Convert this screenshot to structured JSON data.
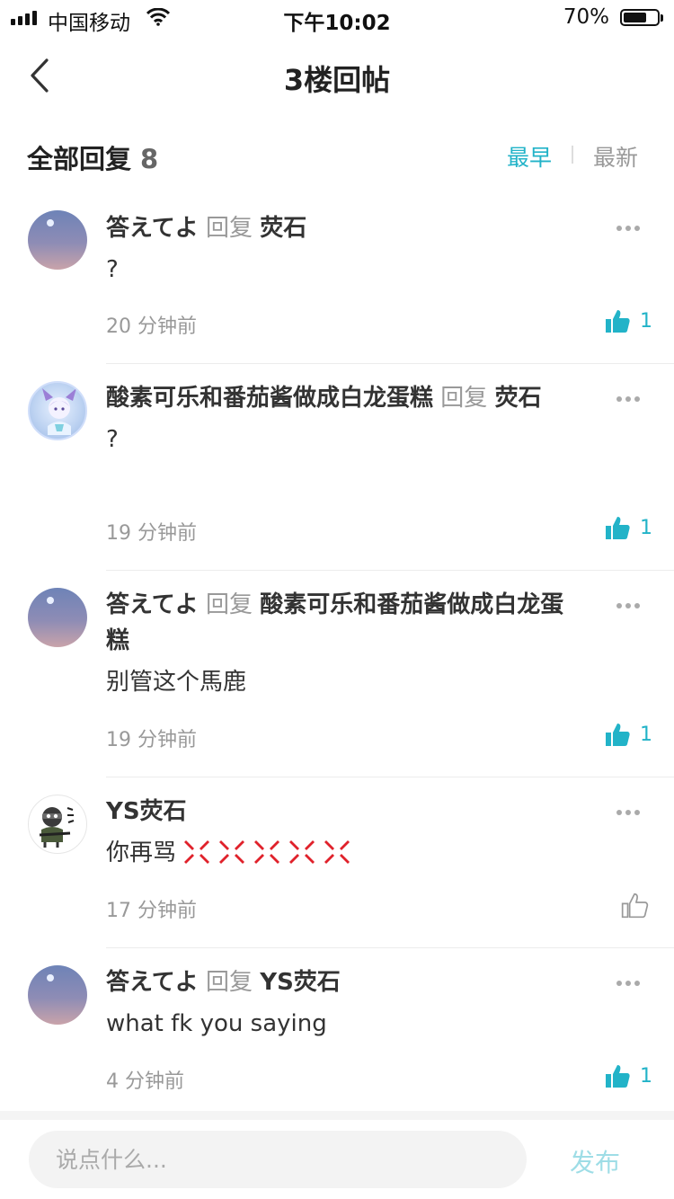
{
  "status_bar": {
    "carrier": "中国移动",
    "time": "下午10:02",
    "battery": "70%",
    "battery_level": 0.7
  },
  "nav": {
    "title": "3楼回帖"
  },
  "header": {
    "title": "全部回复",
    "count": "8",
    "sort_earliest": "最早",
    "sort_newest": "最新"
  },
  "reply_word": "回复",
  "comments": [
    {
      "user": "答えてよ",
      "target": "荧石",
      "text": "?",
      "time": "20 分钟前",
      "likes": "1",
      "liked": true
    },
    {
      "user": "酸素可乐和番茄酱做成白龙蛋糕",
      "target": "荧石",
      "text": "?",
      "time": "19 分钟前",
      "likes": "1",
      "liked": true
    },
    {
      "user": "答えてよ",
      "target": "酸素可乐和番茄酱做成白龙蛋糕",
      "text": "别管这个馬鹿",
      "time": "19 分钟前",
      "likes": "1",
      "liked": true
    },
    {
      "user": "YS荧石",
      "target": "",
      "text": "你再骂",
      "time": "17 分钟前",
      "likes": "",
      "liked": false
    },
    {
      "user": "答えてよ",
      "target": "YS荧石",
      "text": "what fk you saying",
      "time": "4 分钟前",
      "likes": "1",
      "liked": true
    }
  ],
  "composer": {
    "placeholder": "说点什么...",
    "send_label": "发布"
  },
  "colors": {
    "accent": "#22b3c8",
    "muted": "#999999",
    "send_disabled": "#9edde6",
    "angry": "#e0212b"
  },
  "icons": {
    "back": "chevron-left-icon",
    "more": "more-dots-icon",
    "like": "thumbs-up-icon",
    "angry": "anger-symbol-icon"
  }
}
